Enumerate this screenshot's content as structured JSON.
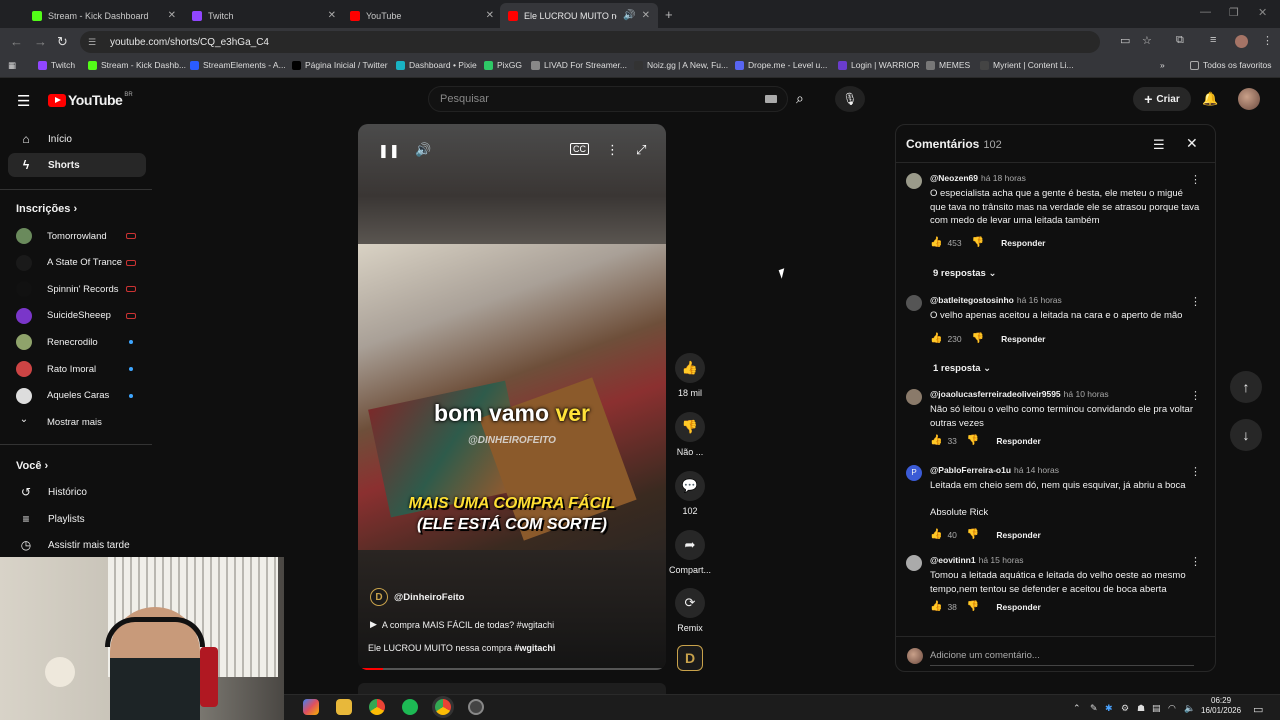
{
  "browser": {
    "tabs": [
      {
        "title": "Stream - Kick Dashboard",
        "favicon_color": "#53fc18",
        "active": false
      },
      {
        "title": "Twitch",
        "favicon_color": "#9146ff",
        "active": false
      },
      {
        "title": "YouTube",
        "favicon_color": "#ff0000",
        "active": false
      },
      {
        "title": "Ele LUCROU MUITO nessa c",
        "favicon_color": "#ff0000",
        "active": true
      }
    ],
    "new_tab": "+",
    "url": "youtube.com/shorts/CQ_e3hGa_C4",
    "bookmarks": [
      {
        "label": "Twitch",
        "color": "#9146ff"
      },
      {
        "label": "Stream - Kick Dashb...",
        "color": "#53fc18"
      },
      {
        "label": "StreamElements - A...",
        "color": "#2a5cff"
      },
      {
        "label": "Página Inicial / Twitter",
        "color": "#000000"
      },
      {
        "label": "Dashboard • Pixie",
        "color": "#19b3c4"
      },
      {
        "label": "PixGG",
        "color": "#2ec866"
      },
      {
        "label": "LIVAD For Streamer...",
        "color": "#888888"
      },
      {
        "label": "Noiz.gg | A New, Fu...",
        "color": "#333333"
      },
      {
        "label": "Drope.me - Level u...",
        "color": "#5865f2"
      },
      {
        "label": "Login | WARRIOR",
        "color": "#6a3ccc"
      },
      {
        "label": "MEMES",
        "color": "#777777"
      },
      {
        "label": "Myrient | Content Li...",
        "color": "#444444"
      }
    ],
    "all_favorites": "Todos os favoritos"
  },
  "header": {
    "logo_text": "YouTube",
    "country_code": "BR",
    "search_placeholder": "Pesquisar",
    "create_label": "Criar"
  },
  "sidebar": {
    "main": [
      {
        "label": "Início",
        "icon": "home-icon"
      },
      {
        "label": "Shorts",
        "icon": "shorts-icon"
      }
    ],
    "subs_heading": "Inscrições",
    "subscriptions": [
      {
        "name": "Tomorrowland",
        "color": "#6a8a5c",
        "status": "live"
      },
      {
        "name": "A State Of Trance",
        "color": "#1a1a1a",
        "status": "live"
      },
      {
        "name": "Spinnin' Records",
        "color": "#111111",
        "status": "live"
      },
      {
        "name": "SuicideSheeep",
        "color": "#7a36c9",
        "status": "live"
      },
      {
        "name": "Renecrodilo",
        "color": "#8fa36b",
        "status": "new"
      },
      {
        "name": "Rato Imoral",
        "color": "#c44",
        "status": "new"
      },
      {
        "name": "Aqueles Caras",
        "color": "#ddd",
        "status": "new"
      }
    ],
    "show_more": "Mostrar mais",
    "you_heading": "Você",
    "you_items": [
      {
        "label": "Histórico",
        "icon": "history-icon"
      },
      {
        "label": "Playlists",
        "icon": "playlists-icon"
      },
      {
        "label": "Assistir mais tarde",
        "icon": "watch-later-icon"
      }
    ]
  },
  "video": {
    "caption_main": "bom vamo",
    "caption_highlight": "ver",
    "watermark": "@DINHEIROFEITO",
    "caption_line1": "MAIS UMA COMPRA FÁCIL",
    "caption_line2": "(ELE ESTÁ COM SORTE)",
    "channel": "@DinheiroFeito",
    "channel_initial": "D",
    "song": "A compra MAIS FÁCIL de todas? #wgitachi",
    "title_prefix": "Ele LUCROU MUITO nessa compra ",
    "title_hashtag": "#wgitachi",
    "progress": 0.07
  },
  "actions": [
    {
      "label": "18 mil",
      "icon": "like-icon",
      "glyph": "👍"
    },
    {
      "label": "Não ...",
      "icon": "dislike-icon",
      "glyph": "👎"
    },
    {
      "label": "102",
      "icon": "comment-icon",
      "glyph": "💬"
    },
    {
      "label": "Compart...",
      "icon": "share-icon",
      "glyph": "➦"
    },
    {
      "label": "Remix",
      "icon": "remix-icon",
      "glyph": "⟳"
    }
  ],
  "comments_panel": {
    "title": "Comentários",
    "count": "102",
    "reply_label": "Responder",
    "add_placeholder": "Adicione um comentário...",
    "comments": [
      {
        "user": "@Neozen69",
        "when": "há 18 horas",
        "text": "O especialista acha que a gente é besta, ele meteu o migué que tava no trânsito mas na verdade ele se atrasou porque tava com medo de levar uma leitada também",
        "likes": "453",
        "replies": "9 respostas",
        "avatar_color": "#9a9a8a"
      },
      {
        "user": "@batleitegostosinho",
        "when": "há 16 horas",
        "text": "O velho apenas aceitou a leitada na cara e o aperto de mão",
        "likes": "230",
        "replies": "1 resposta",
        "avatar_color": "#555555"
      },
      {
        "user": "@joaolucasferreiradeoliveir9595",
        "when": "há 10 horas",
        "text": "Não só leitou o velho como terminou convidando ele pra voltar outras vezes",
        "likes": "33",
        "replies": "",
        "avatar_color": "#8a7a6a"
      },
      {
        "user": "@PabloFerreira-o1u",
        "when": "há 14 horas",
        "text": "Leitada em cheio sem dó, nem quis esquivar, já abriu a boca\n\nAbsolute Rick",
        "likes": "40",
        "replies": "",
        "avatar_color": "#3b5bd6",
        "initial": "P"
      },
      {
        "user": "@eovitinn1",
        "when": "há 15 horas",
        "text": "Tomou a leitada aquática e leitada do velho oeste ao mesmo tempo,nem tentou se defender e aceitou de boca aberta",
        "likes": "38",
        "replies": "",
        "avatar_color": "#aaaaaa"
      }
    ]
  },
  "taskbar": {
    "time": "06:29",
    "date": "16/01/2026"
  }
}
